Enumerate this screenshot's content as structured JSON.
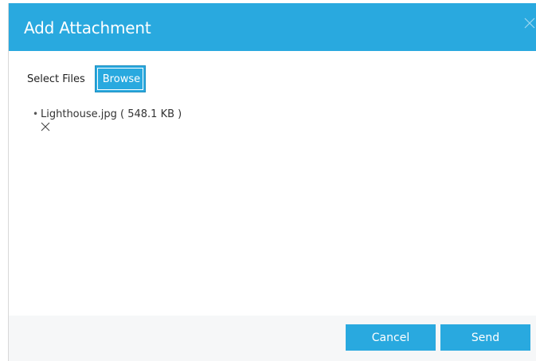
{
  "dialog": {
    "title": "Add Attachment",
    "close_icon": "close-icon"
  },
  "upload": {
    "select_label": "Select Files",
    "browse_label": "Browse",
    "files": [
      {
        "name_size": "Lighthouse.jpg ( 548.1 KB )",
        "remove_icon": "close-icon"
      }
    ]
  },
  "footer": {
    "cancel_label": "Cancel",
    "send_label": "Send"
  },
  "colors": {
    "accent": "#29a9df",
    "footer_bg": "#f6f7f8"
  }
}
